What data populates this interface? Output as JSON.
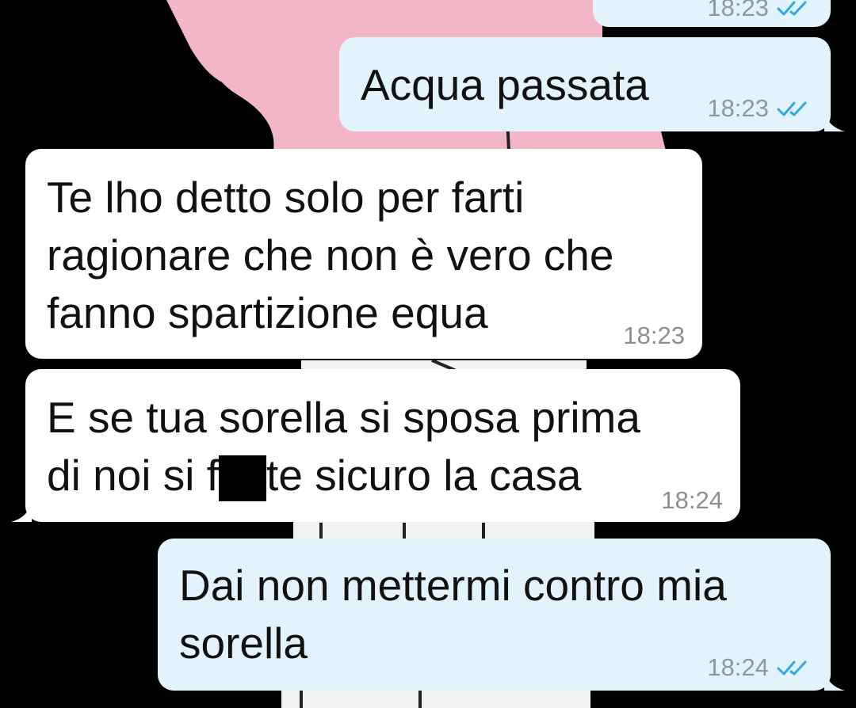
{
  "chat": {
    "colors": {
      "outgoing_bubble": "#e2f3fb",
      "incoming_bubble": "#ffffff",
      "read_ticks": "#34a8e0",
      "background": "#000000"
    },
    "messages": [
      {
        "direction": "out",
        "text": "",
        "time": "18:23",
        "status": "read"
      },
      {
        "direction": "out",
        "text": "Acqua passata",
        "time": "18:23",
        "status": "read"
      },
      {
        "direction": "in",
        "lines": [
          "Te lho detto solo per farti",
          "ragionare che non è vero che",
          "fanno spartizione equa"
        ],
        "time": "18:23"
      },
      {
        "direction": "in",
        "line1": "E se tua sorella si sposa prima",
        "line2_before": "di noi si f",
        "line2_after": "te sicuro la casa",
        "redacted": true,
        "time": "18:24"
      },
      {
        "direction": "out",
        "lines": [
          "Dai non mettermi contro mia",
          "sorella"
        ],
        "time": "18:24",
        "status": "read"
      }
    ]
  }
}
